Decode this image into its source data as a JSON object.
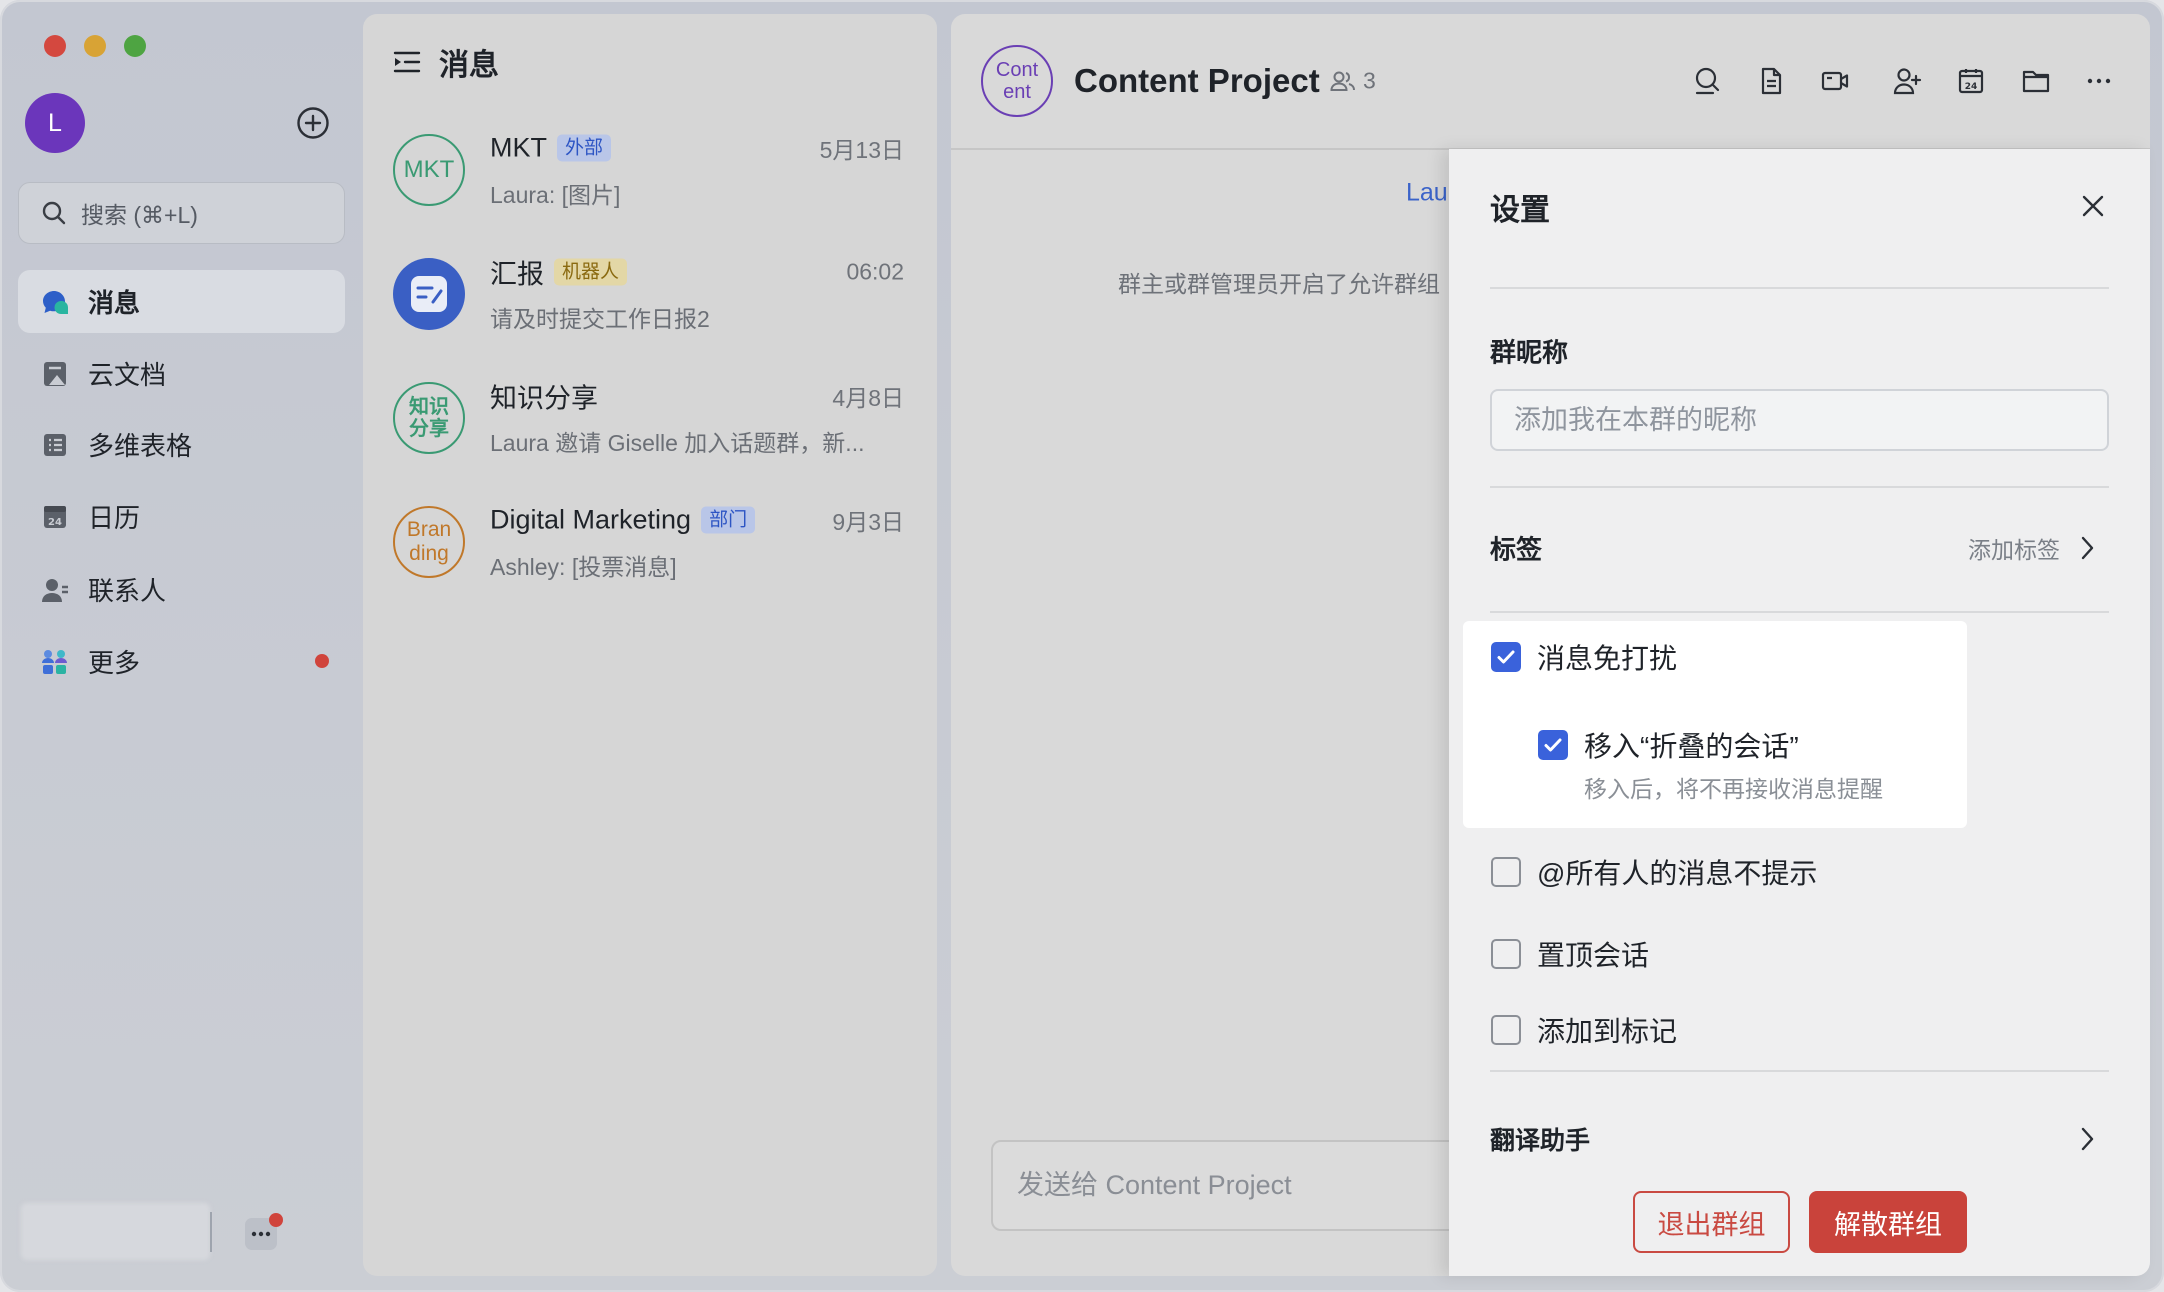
{
  "colors": {
    "accent": "#3a62db",
    "danger": "#c9433b",
    "text": "#1f2329",
    "link": "#3b63c9"
  },
  "sidebar": {
    "user_initial": "L",
    "search_placeholder": "搜索 (⌘+L)",
    "nav": [
      {
        "label": "消息",
        "icon": "message-icon",
        "selected": true
      },
      {
        "label": "云文档",
        "icon": "cloud-docs-icon",
        "selected": false
      },
      {
        "label": "多维表格",
        "icon": "base-table-icon",
        "selected": false
      },
      {
        "label": "日历",
        "icon": "calendar-icon",
        "icon_text": "24",
        "selected": false
      },
      {
        "label": "联系人",
        "icon": "contacts-icon",
        "selected": false
      },
      {
        "label": "更多",
        "icon": "more-apps-icon",
        "selected": false,
        "has_dot": true
      }
    ]
  },
  "message_list": {
    "title": "消息",
    "items": [
      {
        "name": "MKT",
        "badge": "外部",
        "badge_bg": "#b9c6e8",
        "badge_fg": "#2d55c4",
        "time": "5月13日",
        "preview": "Laura: [图片]",
        "avatar_lines": [
          "MKT"
        ],
        "avatar_color": "#3a9a73"
      },
      {
        "name": "汇报",
        "badge": "机器人",
        "badge_bg": "#e3d7a6",
        "badge_fg": "#8a6a10",
        "time": "06:02",
        "preview": "请及时提交工作日报2",
        "avatar_icon": "report-bot-icon",
        "avatar_color": "#3a5fc4"
      },
      {
        "name": "知识分享",
        "time": "4月8日",
        "preview": "Laura 邀请 Giselle 加入话题群，新...",
        "avatar_lines": [
          "知识",
          "分享"
        ],
        "avatar_color": "#3a9a73"
      },
      {
        "name": "Digital Marketing",
        "badge": "部门",
        "badge_bg": "#b9c6e8",
        "badge_fg": "#2d55c4",
        "time": "9月3日",
        "preview": "Ashley: [投票消息]",
        "avatar_lines": [
          "Bran",
          "ding"
        ],
        "avatar_color": "#c0782a"
      }
    ]
  },
  "chat": {
    "avatar_lines": [
      "Cont",
      "ent"
    ],
    "title": "Content Project",
    "member_count": "3",
    "header_icons": [
      "search-chat-icon",
      "document-icon",
      "video-call-icon",
      "add-member-icon",
      "calendar-icon",
      "folder-icon",
      "more-icon"
    ],
    "calendar_icon_text": "24",
    "sender_name": "Lau",
    "system_notice": "群主或群管理员开启了允许群组",
    "input_placeholder": "发送给 Content Project"
  },
  "settings": {
    "title": "设置",
    "nickname_label": "群昵称",
    "nickname_placeholder": "添加我在本群的昵称",
    "tags_label": "标签",
    "tags_action": "添加标签",
    "options": [
      {
        "label": "消息免打扰",
        "checked": true
      },
      {
        "label": "移入“折叠的会话”",
        "checked": true,
        "hint": "移入后，将不再接收消息提醒"
      },
      {
        "label": "@所有人的消息不提示",
        "checked": false
      },
      {
        "label": "置顶会话",
        "checked": false
      },
      {
        "label": "添加到标记",
        "checked": false
      }
    ],
    "translate_label": "翻译助手",
    "leave_button": "退出群组",
    "disband_button": "解散群组"
  }
}
